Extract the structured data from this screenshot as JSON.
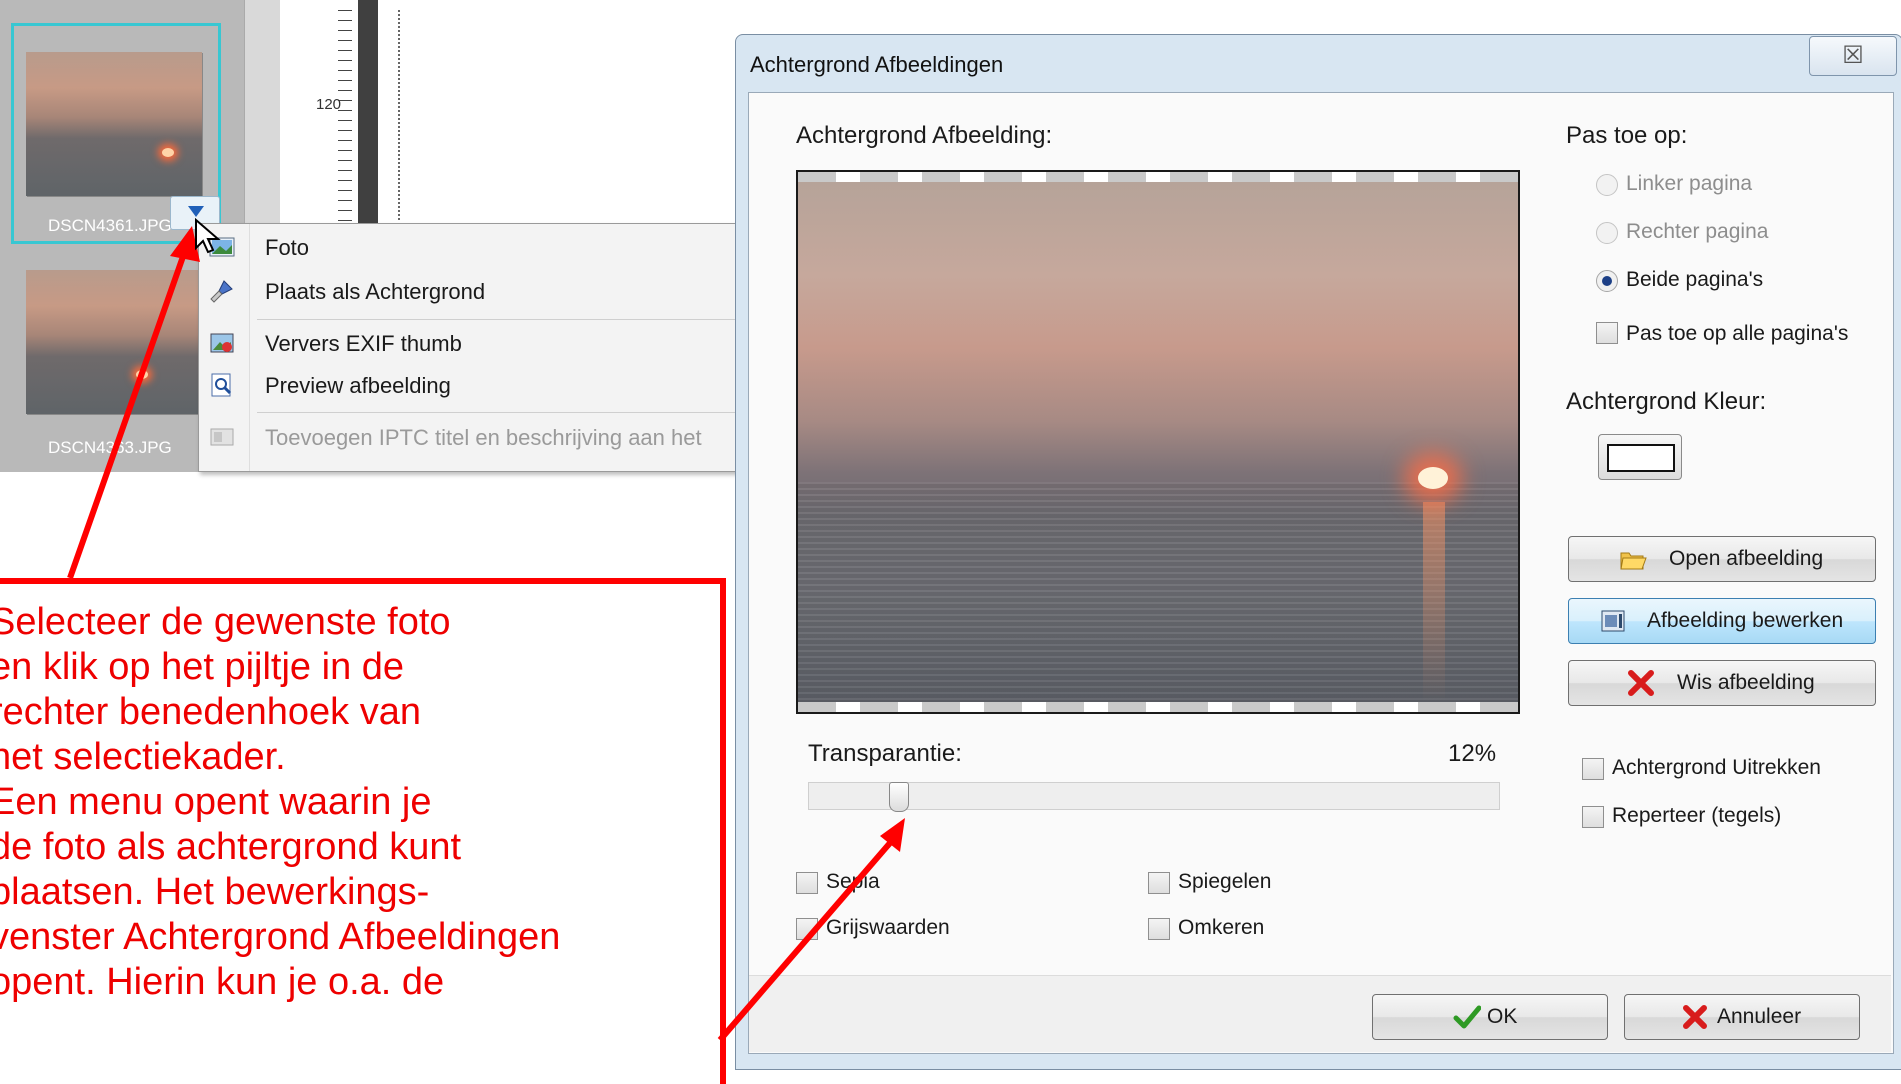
{
  "thumbnails": [
    {
      "filename": "DSCN4361.JPG",
      "selected": true
    },
    {
      "filename": "DSCN4363.JPG",
      "selected": false
    }
  ],
  "ruler": {
    "label": "120"
  },
  "context_menu": {
    "items": [
      {
        "label": "Foto",
        "icon": "photo-icon",
        "enabled": true
      },
      {
        "label": "Plaats als Achtergrond",
        "icon": "brush-icon",
        "enabled": true
      },
      {
        "label": "Ververs EXIF thumb",
        "icon": "refresh-thumb-icon",
        "enabled": true
      },
      {
        "label": "Preview afbeelding",
        "icon": "preview-icon",
        "enabled": true
      },
      {
        "label": "Toevoegen IPTC titel en beschrijving aan het",
        "icon": "iptc-icon",
        "enabled": false
      }
    ]
  },
  "dialog": {
    "title": "Achtergrond Afbeeldingen",
    "close_glyph": "☒",
    "image_heading": "Achtergrond Afbeelding:",
    "apply_heading": "Pas toe op:",
    "radios": [
      {
        "label": "Linker pagina",
        "checked": false,
        "enabled": false
      },
      {
        "label": "Rechter pagina",
        "checked": false,
        "enabled": false
      },
      {
        "label": "Beide pagina's",
        "checked": true,
        "enabled": true
      }
    ],
    "apply_all_label": "Pas toe op alle pagina's",
    "bg_color_heading": "Achtergrond Kleur:",
    "bg_color": "#ffffff",
    "buttons": {
      "open": "Open afbeelding",
      "edit": "Afbeelding bewerken",
      "delete": "Wis afbeelding",
      "ok": "OK",
      "cancel": "Annuleer"
    },
    "stretch_label": "Achtergrond Uitrekken",
    "tile_label": "Reperteer (tegels)",
    "transparency_label": "Transparantie:",
    "transparency_value": "12%",
    "transparency_fraction": 0.12,
    "effects": {
      "sepia": "Sepia",
      "grayscale": "Grijswaarden",
      "mirror": "Spiegelen",
      "invert": "Omkeren"
    }
  },
  "annotation": {
    "text": "Selecteer de gewenste foto\nen klik op het pijltje in de\nrechter benedenhoek van\nhet selectiekader.\nEen menu opent waarin je\nde foto als achtergrond kunt\nplaatsen. Het bewerkings-\nvenster Achtergrond Afbeeldingen\nopent. Hierin kun je o.a. de",
    "color": "#ff0000"
  },
  "colors": {
    "selection": "#38c7d2",
    "accent": "#3c7fb1"
  }
}
